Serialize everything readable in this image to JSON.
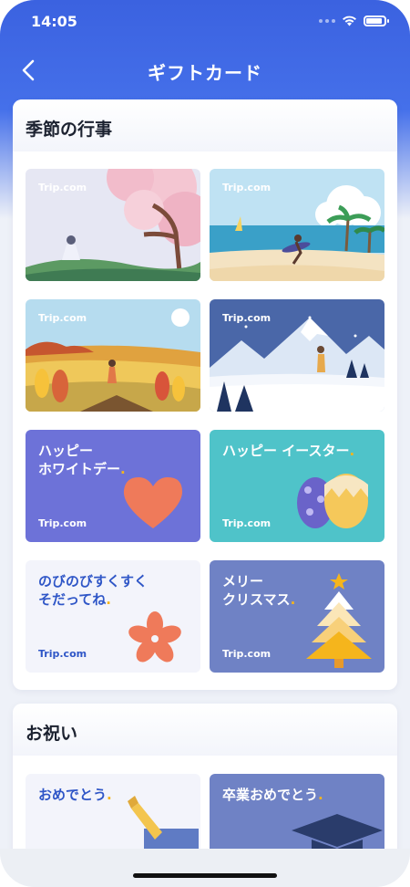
{
  "status_bar": {
    "time": "14:05"
  },
  "nav": {
    "title": "ギフトカード"
  },
  "sections": [
    {
      "title": "季節の行事",
      "cards": [
        {
          "brand": "Trip.com",
          "scene": "cherry-blossom"
        },
        {
          "brand": "Trip.com",
          "scene": "beach-surfer"
        },
        {
          "brand": "Trip.com",
          "scene": "autumn-field"
        },
        {
          "brand": "Trip.com",
          "scene": "snow-mountains"
        },
        {
          "brand": "Trip.com",
          "message": "ハッピー\nホワイトデー",
          "scene": "heart"
        },
        {
          "brand": "Trip.com",
          "message": "ハッピー イースター",
          "scene": "easter-eggs"
        },
        {
          "brand": "Trip.com",
          "message": "のびのびすくすく\nそだってね",
          "scene": "flower"
        },
        {
          "brand": "Trip.com",
          "message": "メリー\nクリスマス",
          "scene": "christmas-tree"
        }
      ]
    },
    {
      "title": "お祝い",
      "cards": [
        {
          "message": "おめでとう",
          "scene": "champagne"
        },
        {
          "message": "卒業おめでとう",
          "scene": "graduation-cap"
        }
      ]
    }
  ],
  "colors": {
    "accent": "#3b62e0",
    "brand_blue": "#2f56c7",
    "dot": "#f5b51c"
  }
}
